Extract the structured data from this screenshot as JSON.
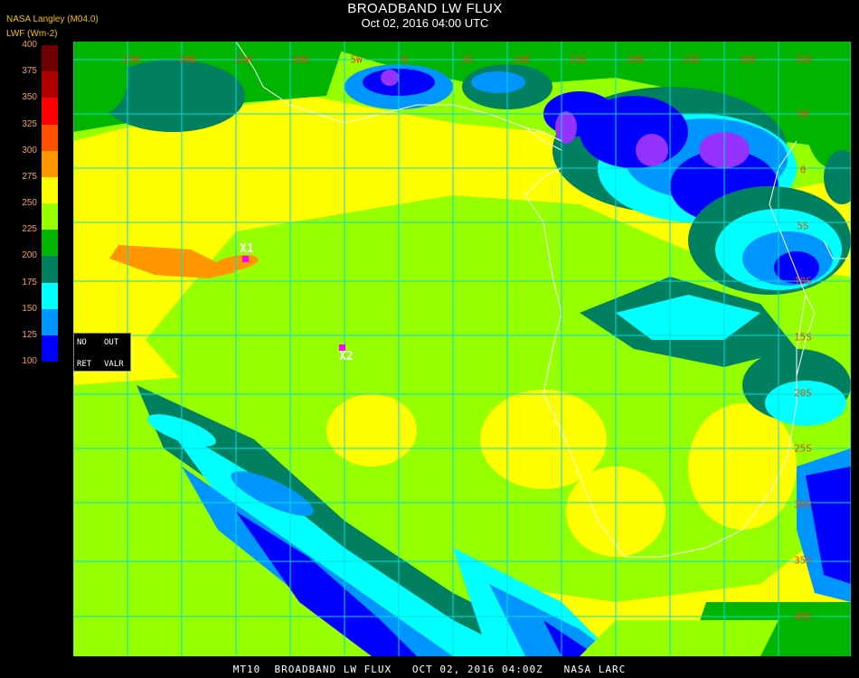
{
  "header": {
    "title": "BROADBAND LW FLUX",
    "subtitle": "Oct 02, 2016 04:00 UTC",
    "source": "NASA Langley (M04.0)",
    "unit": "LWF (Wm-2)"
  },
  "legend": {
    "labels": [
      "400",
      "375",
      "350",
      "325",
      "300",
      "275",
      "250",
      "225",
      "200",
      "175",
      "150",
      "125",
      "100"
    ],
    "colors": [
      "#700000",
      "#b00000",
      "#ff0000",
      "#ff5000",
      "#ff9600",
      "#ffff00",
      "#96ff00",
      "#00b400",
      "#008060",
      "#00ffff",
      "#0096ff",
      "#0000ff",
      "#9632ff"
    ]
  },
  "map": {
    "longitude_labels": [
      "25W",
      "20W",
      "15W",
      "10W",
      "5W",
      "0",
      "5E",
      "10E",
      "15E",
      "20E",
      "25E",
      "30E",
      "35E"
    ],
    "latitude_labels": [
      "5N",
      "0",
      "5S",
      "10S",
      "15S",
      "20S",
      "25S",
      "30S",
      "35S",
      "40S"
    ],
    "colors": {
      "grid": "#00dcdc",
      "coast": "#ffffff",
      "background": "#ffff00"
    }
  },
  "markers": [
    {
      "label": "X1"
    },
    {
      "label": "X2"
    }
  ],
  "status_box": {
    "row1_left": "NO",
    "row1_right": "OUT",
    "row2_left": "RET",
    "row2_right": "VALR"
  },
  "footer": "MT10  BROADBAND LW FLUX   OCT 02, 2016 04:00Z   NASA LARC"
}
